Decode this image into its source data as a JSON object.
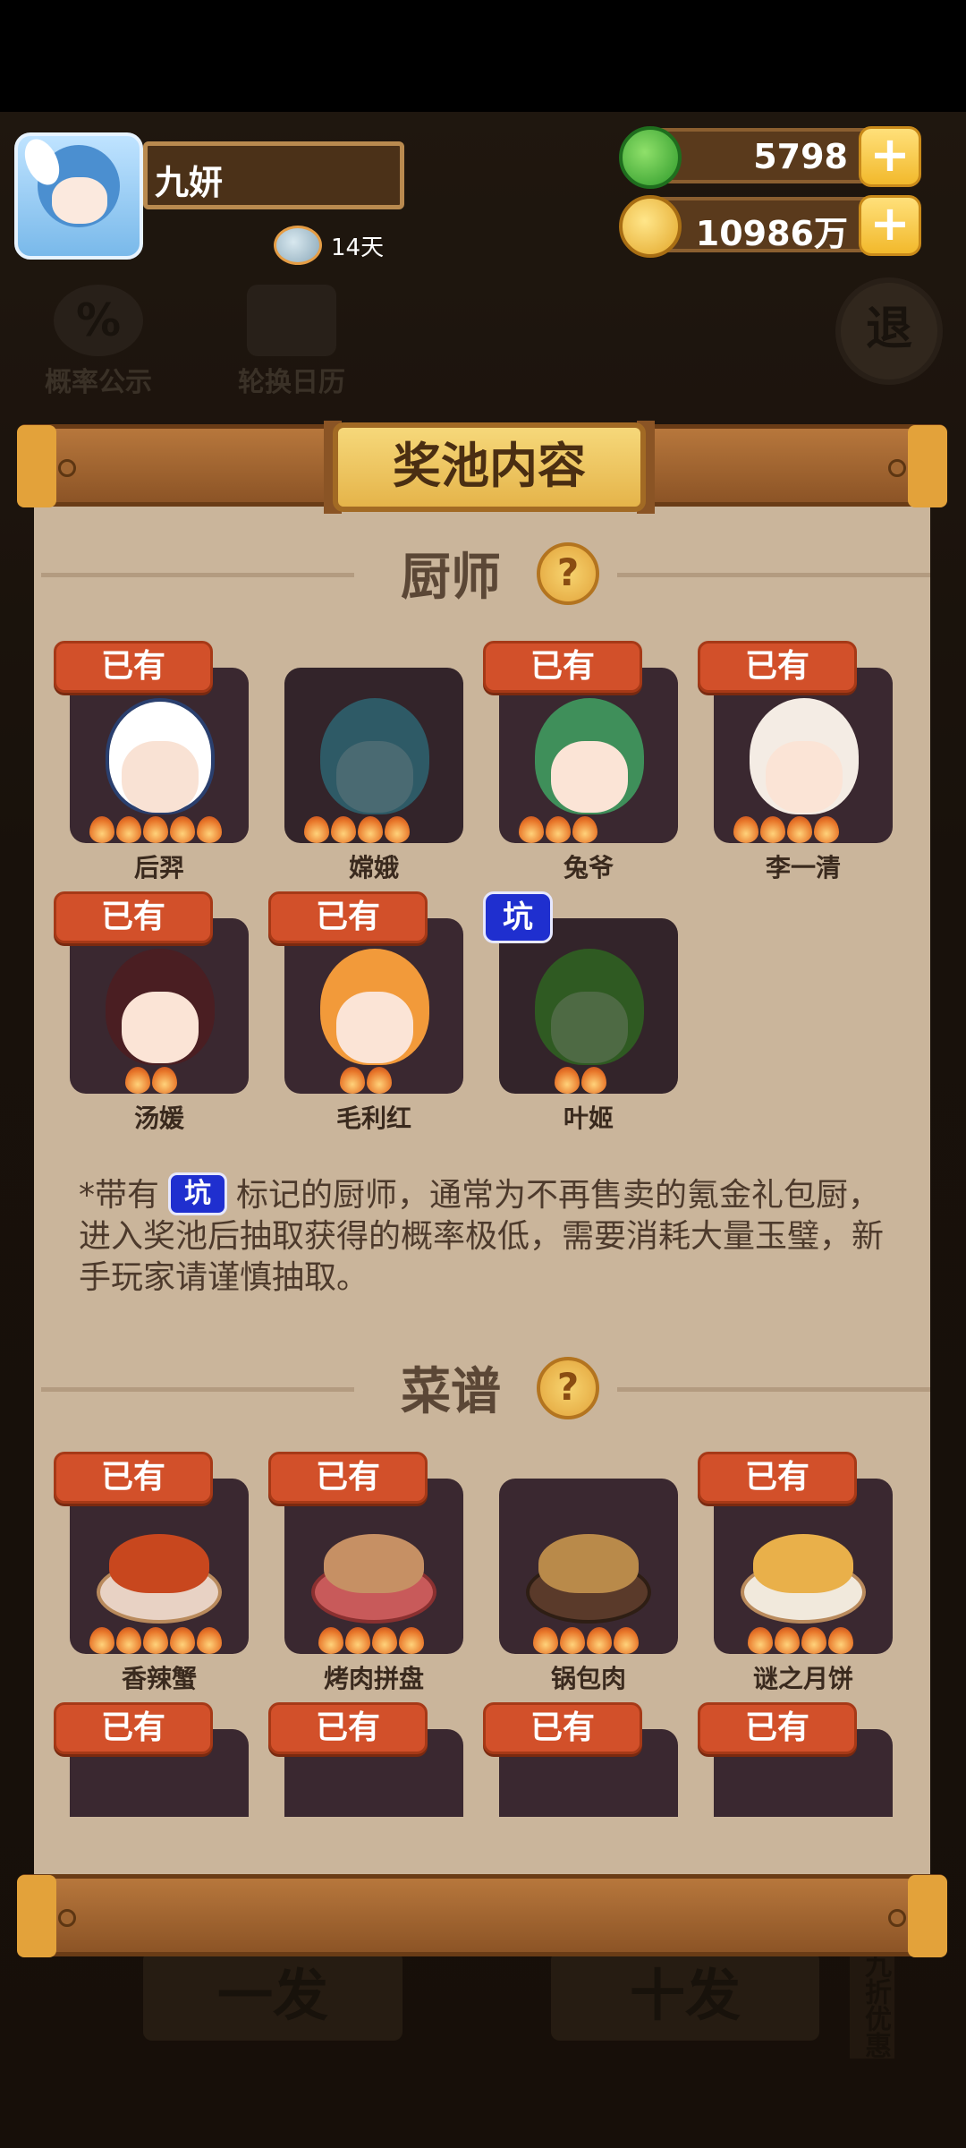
{
  "player": {
    "name": "九妍",
    "days": "14天"
  },
  "currency": {
    "jade": "5798",
    "coins": "10986万"
  },
  "background": {
    "prob_label": "概率公示",
    "calendar_label": "轮换日历",
    "exit_label": "退",
    "single_draw": "一发",
    "ten_draw": "十发",
    "discount": "九折优惠"
  },
  "modal": {
    "title": "奖池内容",
    "chef_section": "厨师",
    "recipe_section": "菜谱",
    "owned_label": "已有",
    "keng_label": "坑",
    "chefs": [
      {
        "name": "后羿",
        "owned": true,
        "flames": 5
      },
      {
        "name": "嫦娥",
        "owned": false,
        "flames": 4
      },
      {
        "name": "兔爷",
        "owned": true,
        "flames": 3
      },
      {
        "name": "李一清",
        "owned": true,
        "flames": 4
      },
      {
        "name": "汤媛",
        "owned": true,
        "flames": 2
      },
      {
        "name": "毛利红",
        "owned": true,
        "flames": 2
      },
      {
        "name": "叶姬",
        "owned": false,
        "keng": true,
        "flames": 2
      }
    ],
    "note_prefix": "*带有",
    "note_text": "标记的厨师，通常为不再售卖的氪金礼包厨，进入奖池后抽取获得的概率极低，需要消耗大量玉璧，新手玩家请谨慎抽取。",
    "recipes": [
      {
        "name": "香辣蟹",
        "owned": true,
        "flames": 5
      },
      {
        "name": "烤肉拼盘",
        "owned": true,
        "flames": 4
      },
      {
        "name": "锅包肉",
        "owned": false,
        "flames": 4
      },
      {
        "name": "谜之月饼",
        "owned": true,
        "flames": 4
      },
      {
        "name": "",
        "owned": true,
        "flames": 0
      },
      {
        "name": "",
        "owned": true,
        "flames": 0
      },
      {
        "name": "",
        "owned": true,
        "flames": 0
      },
      {
        "name": "",
        "owned": true,
        "flames": 0
      }
    ]
  }
}
